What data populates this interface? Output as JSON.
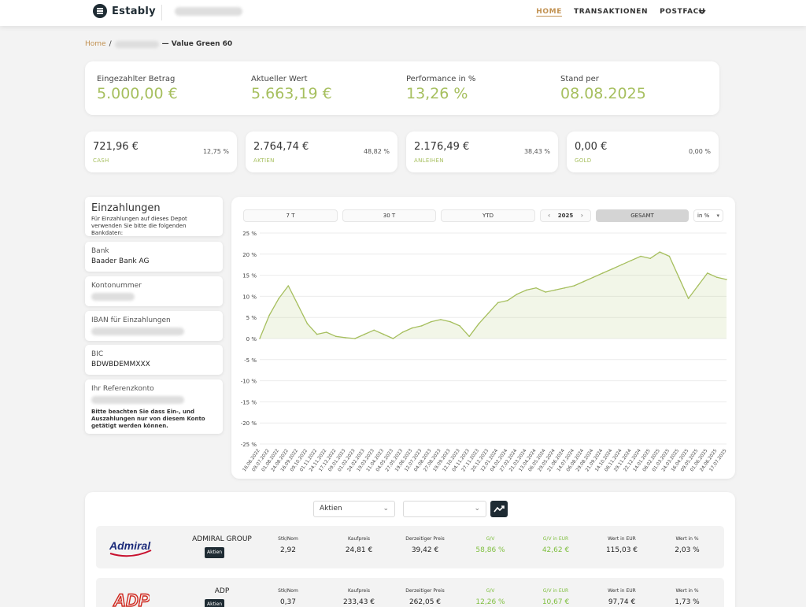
{
  "header": {
    "brand": "Estably",
    "nav": [
      "HOME",
      "TRANSAKTIONEN",
      "POSTFACH"
    ]
  },
  "breadcrumb": {
    "home": "Home",
    "separator": "/",
    "title": "— Value Green 60"
  },
  "summary": [
    {
      "label": "Eingezahlter Betrag",
      "value": "5.000,00 €"
    },
    {
      "label": "Aktueller Wert",
      "value": "5.663,19 €"
    },
    {
      "label": "Performance in %",
      "value": "13,26 %"
    },
    {
      "label": "Stand per",
      "value": "08.08.2025"
    }
  ],
  "allocation": [
    {
      "amount": "721,96 €",
      "percent": "12,75 %",
      "category": "CASH"
    },
    {
      "amount": "2.764,74 €",
      "percent": "48,82 %",
      "category": "AKTIEN"
    },
    {
      "amount": "2.176,49 €",
      "percent": "38,43 %",
      "category": "ANLEIHEN"
    },
    {
      "amount": "0,00 €",
      "percent": "0,00 %",
      "category": "GOLD"
    }
  ],
  "deposit": {
    "title": "Einzahlungen",
    "note": "Für Einzahlungen auf dieses Depot verwenden Sie bitte die folgenden Bankdaten:",
    "bank_label": "Bank",
    "bank_value": "Baader Bank AG",
    "account_label": "Kontonummer",
    "iban_label": "IBAN für Einzahlungen",
    "bic_label": "BIC",
    "bic_value": "BDWBDEMMXXX",
    "ref_label": "Ihr Referenzkonto",
    "ref_note": "Bitte beachten Sie dass Ein-, und Auszahlungen nur von diesem Konto getätigt werden können."
  },
  "chart_controls": {
    "periods": [
      "7 T",
      "30 T",
      "YTD"
    ],
    "year": "2025",
    "prev": "‹",
    "next": "›",
    "total": "GESAMT",
    "unit": "in %"
  },
  "chart_data": {
    "type": "area",
    "title": "",
    "xlabel": "",
    "ylabel": "",
    "ylim": [
      -25,
      25
    ],
    "yticks": [
      "25 %",
      "20 %",
      "15 %",
      "10 %",
      "5 %",
      "0 %",
      "-5 %",
      "-10 %",
      "-15 %",
      "-20 %",
      "-25 %"
    ],
    "x": [
      "16.06.2022",
      "09.07.2022",
      "01.08.2022",
      "24.08.2022",
      "16.09.2022",
      "09.10.2022",
      "01.11.2022",
      "24.11.2022",
      "17.12.2022",
      "09.01.2023",
      "01.02.2023",
      "24.02.2023",
      "19.03.2023",
      "11.04.2023",
      "04.05.2023",
      "27.05.2023",
      "19.06.2023",
      "12.07.2023",
      "04.08.2023",
      "27.08.2023",
      "19.09.2023",
      "12.10.2023",
      "04.11.2023",
      "27.11.2023",
      "20.12.2023",
      "12.01.2024",
      "04.02.2024",
      "27.02.2024",
      "21.03.2024",
      "13.04.2024",
      "06.05.2024",
      "29.05.2024",
      "21.06.2024",
      "14.07.2024",
      "06.08.2024",
      "29.08.2024",
      "21.09.2024",
      "14.10.2024",
      "06.11.2024",
      "29.11.2024",
      "22.12.2024",
      "14.01.2025",
      "06.02.2025",
      "01.03.2025",
      "24.03.2025",
      "16.04.2025",
      "09.05.2025",
      "01.06.2025",
      "24.06.2025",
      "17.07.2025"
    ],
    "y": [
      0.0,
      5.5,
      9.5,
      12.5,
      8.0,
      3.5,
      1.0,
      1.5,
      0.5,
      0.2,
      0.0,
      1.0,
      2.0,
      1.0,
      0.0,
      1.5,
      2.5,
      3.0,
      4.0,
      4.5,
      4.0,
      3.0,
      0.5,
      3.5,
      6.0,
      8.5,
      9.0,
      10.5,
      11.5,
      12.0,
      11.0,
      11.5,
      12.0,
      12.5,
      13.5,
      14.5,
      15.5,
      16.5,
      17.5,
      18.5,
      19.5,
      19.0,
      20.5,
      19.5,
      14.5,
      9.5,
      12.5,
      15.5,
      14.5,
      14.0
    ],
    "series": [
      {
        "color": "#a6bf5e"
      }
    ],
    "grid": true,
    "legend": "none"
  },
  "holdings": {
    "filter_type": "Aktien",
    "filter_second": "",
    "columns": [
      "Stk/Nom",
      "Kaufpreis",
      "Derzeitiger Preis",
      "G/V",
      "G/V in EUR",
      "Wert in EUR",
      "Wert in %"
    ],
    "rows": [
      {
        "logo": "Admiral",
        "name": "ADMIRAL GROUP",
        "badge": "Aktien",
        "values": [
          "2,92",
          "24,81 €",
          "39,42 €",
          "58,86 %",
          "42,62 €",
          "115,03 €",
          "2,03 %"
        ]
      },
      {
        "logo": "ADP",
        "name": "ADP",
        "badge": "Aktien",
        "values": [
          "0,37",
          "233,43 €",
          "262,05 €",
          "12,26 %",
          "10,67 €",
          "97,74 €",
          "1,73 %"
        ]
      }
    ]
  },
  "colors": {
    "accent_green": "#a6bf5e",
    "accent_gold": "#c29252",
    "dark": "#1e2b33",
    "gain_green": "#7fbf3f"
  }
}
